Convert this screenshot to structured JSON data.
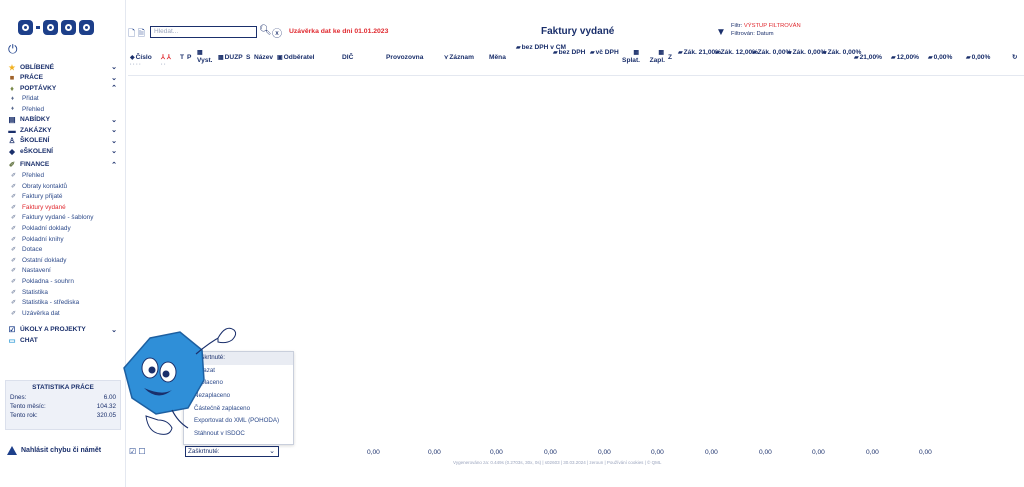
{
  "sidebar": {
    "logo_text": "Q-COM",
    "sections": [
      {
        "label": "OBLÍBENÉ",
        "icon": "star-icon",
        "chev": "⌄"
      },
      {
        "label": "PRÁCE",
        "icon": "briefcase-icon",
        "chev": "⌄"
      },
      {
        "label": "POPTÁVKY",
        "icon": "light-bulb-icon",
        "chev": "⌃"
      },
      {
        "label": "Přidat",
        "icon": "bulb-icon"
      },
      {
        "label": "Přehled",
        "icon": "bulb-icon"
      },
      {
        "label": "NABÍDKY",
        "icon": "document-icon",
        "chev": "⌄"
      },
      {
        "label": "ZAKÁZKY",
        "icon": "clipboard-icon",
        "chev": "⌄"
      },
      {
        "label": "ŠKOLENÍ",
        "icon": "teacher-icon",
        "chev": "⌄"
      },
      {
        "label": "eŠKOLENÍ",
        "icon": "graduation-cap-icon",
        "chev": "⌄"
      },
      {
        "label": "FINANCE",
        "icon": "money-icon",
        "chev": "⌃"
      }
    ],
    "finance_items": [
      "Přehled",
      "Obraty kontaktů",
      "Faktury přijaté",
      "Faktury vydané",
      "Faktury vydané - šablony",
      "Pokladní doklady",
      "Pokladní knihy",
      "Dotace",
      "Ostatní doklady",
      "Nastavení",
      "Pokladna - souhrn",
      "Statistika",
      "Statistika - střediska",
      "Uzávěrka dat"
    ],
    "bottom_sections": [
      {
        "label": "ÚKOLY A PROJEKTY",
        "icon": "checkbox-icon",
        "chev": "⌄"
      },
      {
        "label": "CHAT",
        "icon": "chat-icon"
      }
    ],
    "stats": {
      "title": "STATISTIKA PRÁCE",
      "rows": [
        {
          "label": "Dnes:",
          "value": "6.00"
        },
        {
          "label": "Tento měsíc:",
          "value": "104.32"
        },
        {
          "label": "Tento rok:",
          "value": "320.05"
        }
      ]
    },
    "report_bug": "Nahlásit chybu či námět"
  },
  "toolbar": {
    "search_placeholder": "Hledat...",
    "closing_notice": "Uzávěrka dat ke dni 01.01.2023",
    "title": "Faktury vydané",
    "filter_line1_prefix": "Filtr: ",
    "filter_line1_value": "VÝSTUP FILTROVÁN",
    "filter_line2": "Filtrován: Datum"
  },
  "table_headers": [
    "Číslo",
    "T",
    "P",
    "Vyst.",
    "DUZP",
    "S",
    "Název",
    "Odběratel",
    "DIČ",
    "Provozovna",
    "Záznam",
    "Měna",
    "bez DPH v CM",
    "bez DPH",
    "vč DPH",
    "Splat.",
    "Zapl.",
    "Z",
    "Zák. 21,00%",
    "Zák. 12,00%",
    "Zák. 0,00%",
    "Zák. 0,00%",
    "Zák. 0,00%",
    "21,00%",
    "12,00%",
    "0,00%",
    "0,00%"
  ],
  "popup_items": [
    "Zaškrtnuté:",
    "Smazat",
    "Zaplaceno",
    "Nezaplaceno",
    "Částečně zaplaceno",
    "Exportovat do XML (POHODA)",
    "Stáhnout v ISDOC"
  ],
  "footer": {
    "select_value": "Zaškrtnuté:",
    "sums": [
      "0,00",
      "0,00",
      "0,00",
      "0,00",
      "0,00",
      "0,00",
      "0,00",
      "0,00",
      "0,00",
      "0,00",
      "0,00"
    ],
    "credits": "Vygenerováno za: 0.449s (0.2703s, 30x, 0s) | s02603 | 30.03.2024 | zeroun | Používání cookies | © QML"
  }
}
